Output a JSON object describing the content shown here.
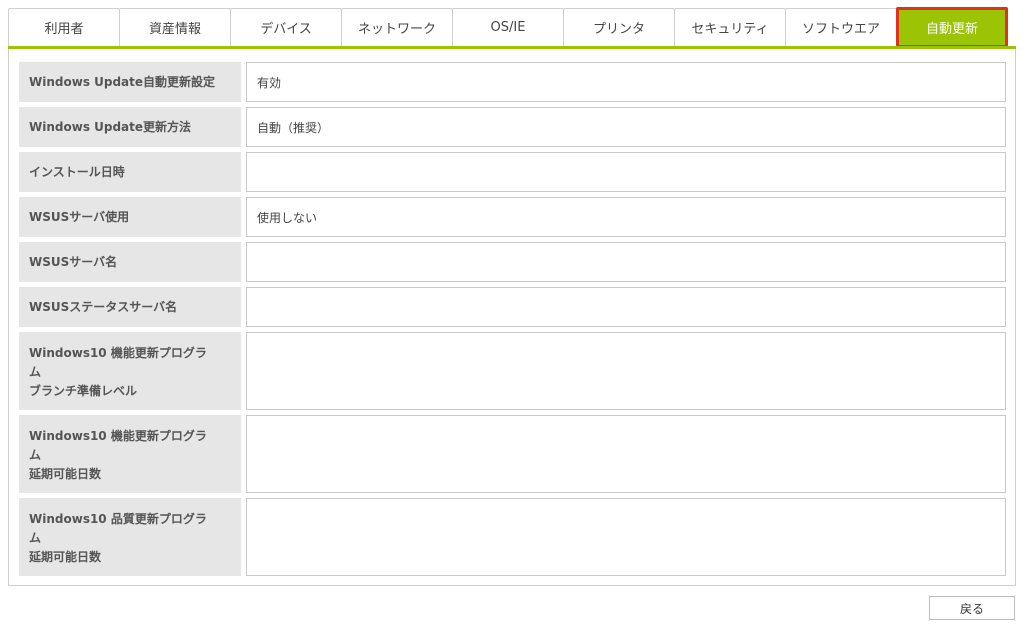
{
  "tabs": [
    {
      "label": "利用者",
      "active": false
    },
    {
      "label": "資産情報",
      "active": false
    },
    {
      "label": "デバイス",
      "active": false
    },
    {
      "label": "ネットワーク",
      "active": false
    },
    {
      "label": "OS/IE",
      "active": false
    },
    {
      "label": "プリンタ",
      "active": false
    },
    {
      "label": "セキュリティ",
      "active": false
    },
    {
      "label": "ソフトウエア",
      "active": false
    },
    {
      "label": "自動更新",
      "active": true
    }
  ],
  "fields": [
    {
      "label": "Windows Update自動更新設定",
      "value": "有効"
    },
    {
      "label": "Windows Update更新方法",
      "value": "自動（推奨）"
    },
    {
      "label": "インストール日時",
      "value": ""
    },
    {
      "label": "WSUSサーバ使用",
      "value": "使用しない"
    },
    {
      "label": "WSUSサーバ名",
      "value": ""
    },
    {
      "label": "WSUSステータスサーバ名",
      "value": ""
    },
    {
      "label": "Windows10 機能更新プログラ\nム\nブランチ準備レベル",
      "value": ""
    },
    {
      "label": "Windows10 機能更新プログラ\nム\n延期可能日数",
      "value": ""
    },
    {
      "label": "Windows10 品質更新プログラ\nム\n延期可能日数",
      "value": ""
    }
  ],
  "back_button": {
    "label": "戻る"
  },
  "colors": {
    "accent": "#9ac404",
    "highlight": "#e0301e",
    "label_bg": "#e6e6e6"
  }
}
